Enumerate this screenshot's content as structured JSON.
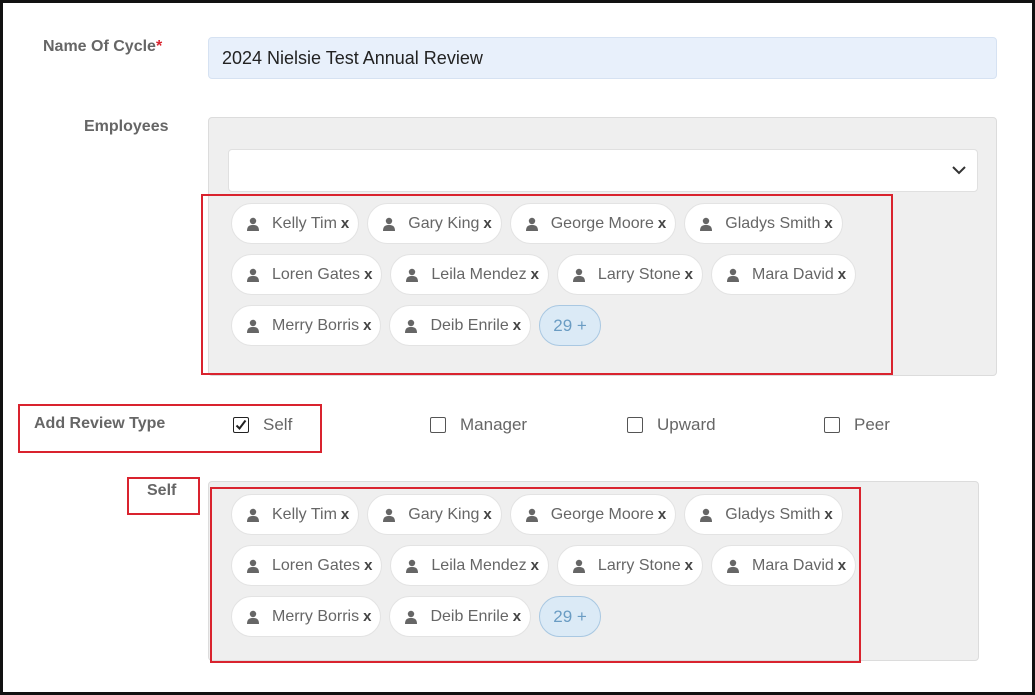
{
  "form": {
    "cycle_name_label": "Name Of Cycle",
    "required_mark": "*",
    "cycle_name_value": "2024 Nielsie Test Annual Review",
    "employees_label": "Employees",
    "employees_select_value": "",
    "review_type_label": "Add Review Type",
    "self_section_label": "Self"
  },
  "review_types": [
    {
      "label": "Self",
      "checked": true
    },
    {
      "label": "Manager",
      "checked": false
    },
    {
      "label": "Upward",
      "checked": false
    },
    {
      "label": "Peer",
      "checked": false
    }
  ],
  "employees": {
    "rows": [
      [
        "Kelly Tim",
        "Gary King",
        "George Moore",
        "Gladys Smith"
      ],
      [
        "Loren Gates",
        "Leila Mendez",
        "Larry Stone",
        "Mara David"
      ],
      [
        "Merry Borris",
        "Deib Enrile"
      ]
    ],
    "more_label": "29 +",
    "remove_label": "x"
  },
  "self_reviewers": {
    "rows": [
      [
        "Kelly Tim",
        "Gary King",
        "George Moore",
        "Gladys Smith"
      ],
      [
        "Loren Gates",
        "Leila Mendez",
        "Larry Stone",
        "Mara David"
      ],
      [
        "Merry Borris",
        "Deib Enrile"
      ]
    ],
    "more_label": "29 +",
    "remove_label": "x"
  },
  "icons": {
    "chip": "user-icon",
    "select": "chevron-down-icon"
  },
  "colors": {
    "highlight": "#d9232e",
    "input_bg": "#e8f0fb",
    "panel_bg": "#efefef",
    "more_chip_bg": "#dbeaf6"
  }
}
